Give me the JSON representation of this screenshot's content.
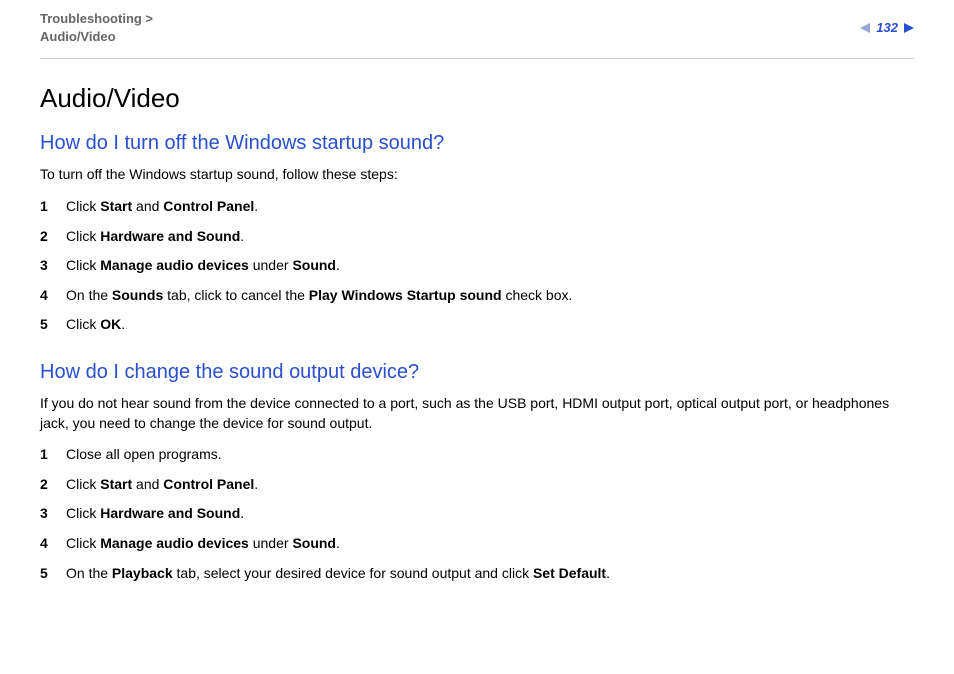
{
  "header": {
    "breadcrumb_parent": "Troubleshooting >",
    "breadcrumb_current": "Audio/Video",
    "page_number": "132"
  },
  "title": "Audio/Video",
  "section1": {
    "heading": "How do I turn off the Windows startup sound?",
    "intro": "To turn off the Windows startup sound, follow these steps:",
    "steps": [
      {
        "n": "1",
        "pre": "Click ",
        "b1": "Start",
        "mid": " and ",
        "b2": "Control Panel",
        "post": "."
      },
      {
        "n": "2",
        "pre": "Click ",
        "b1": "Hardware and Sound",
        "post": "."
      },
      {
        "n": "3",
        "pre": "Click ",
        "b1": "Manage audio devices",
        "mid": " under ",
        "b2": "Sound",
        "post": "."
      },
      {
        "n": "4",
        "pre": "On the ",
        "b1": "Sounds",
        "mid": " tab, click to cancel the ",
        "b2": "Play Windows Startup sound",
        "post": " check box."
      },
      {
        "n": "5",
        "pre": "Click ",
        "b1": "OK",
        "post": "."
      }
    ]
  },
  "section2": {
    "heading": "How do I change the sound output device?",
    "intro": "If you do not hear sound from the device connected to a port, such as the USB port, HDMI output port, optical output port, or headphones jack, you need to change the device for sound output.",
    "steps": [
      {
        "n": "1",
        "pre": "Close all open programs."
      },
      {
        "n": "2",
        "pre": "Click ",
        "b1": "Start",
        "mid": " and ",
        "b2": "Control Panel",
        "post": "."
      },
      {
        "n": "3",
        "pre": "Click ",
        "b1": "Hardware and Sound",
        "post": "."
      },
      {
        "n": "4",
        "pre": "Click ",
        "b1": "Manage audio devices",
        "mid": " under ",
        "b2": "Sound",
        "post": "."
      },
      {
        "n": "5",
        "pre": "On the ",
        "b1": "Playback",
        "mid": " tab, select your desired device for sound output and click ",
        "b2": "Set Default",
        "post": "."
      }
    ]
  }
}
